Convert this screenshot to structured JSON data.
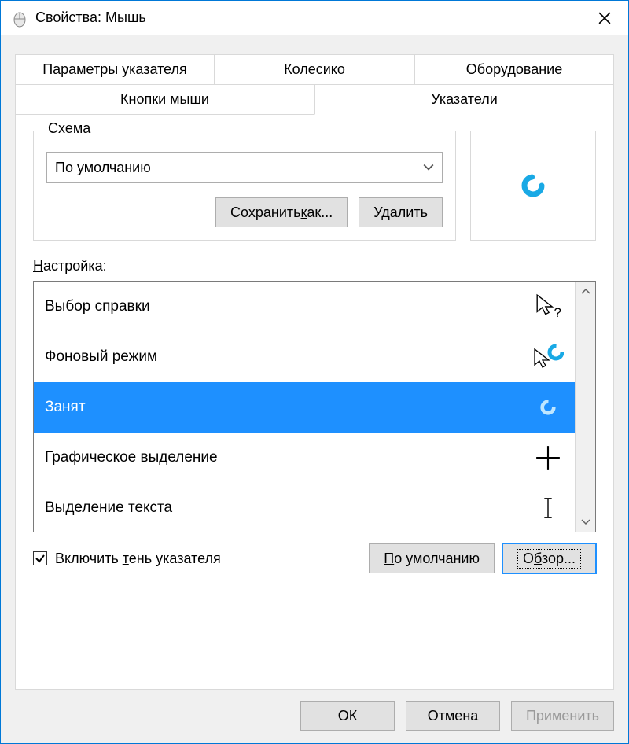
{
  "window": {
    "title": "Свойства: Мышь"
  },
  "tabs": {
    "row1": [
      "Параметры указателя",
      "Колесико",
      "Оборудование"
    ],
    "row2": [
      "Кнопки мыши",
      "Указатели"
    ],
    "active": "Указатели"
  },
  "scheme": {
    "legend_pre": "С",
    "legend_ul": "х",
    "legend_post": "ема",
    "selected": "По умолчанию",
    "save_as_pre": "Сохранить ",
    "save_as_ul": "к",
    "save_as_post": "ак...",
    "delete_label": "Удалить"
  },
  "customize": {
    "label_ul": "Н",
    "label_post": "астройка:"
  },
  "cursors": [
    {
      "label": "Выбор справки",
      "icon": "arrow-help",
      "selected": false
    },
    {
      "label": "Фоновый режим",
      "icon": "arrow-ring",
      "selected": false
    },
    {
      "label": "Занят",
      "icon": "ring",
      "selected": true
    },
    {
      "label": "Графическое выделение",
      "icon": "cross",
      "selected": false
    },
    {
      "label": "Выделение текста",
      "icon": "ibeam",
      "selected": false
    }
  ],
  "shadow": {
    "checked": true,
    "pre": "Включить ",
    "ul": "т",
    "post": "ень указателя"
  },
  "defaults_btn": {
    "ul": "П",
    "post": "о умолчанию"
  },
  "browse_btn": {
    "pre": "О",
    "ul": "б",
    "post": "зор..."
  },
  "dialog_buttons": {
    "ok": "ОК",
    "cancel": "Отмена",
    "apply": "Применить"
  }
}
